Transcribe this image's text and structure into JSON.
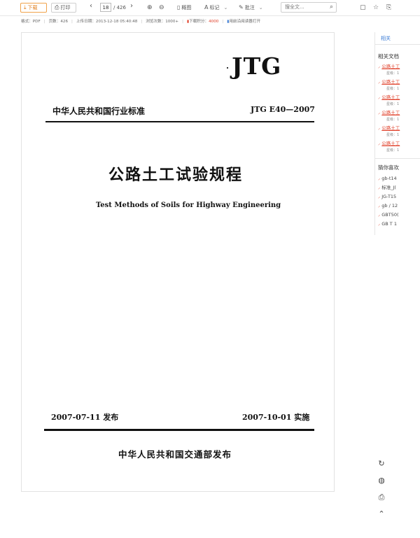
{
  "toolbar": {
    "download": "下载",
    "print": "打印",
    "page_current": "18",
    "page_total": "/ 426",
    "thumbnail": "概图",
    "mark": "标记",
    "annotate": "批注",
    "search_placeholder": "搜全文..."
  },
  "info": {
    "format": "格式：PDF",
    "pages": "页数：426",
    "upload": "上传日期：2013-12-18 05:40:48",
    "views": "浏览次数：1000+",
    "points_label": "下载积分：",
    "points_value": "4000",
    "app_open": "用前沿阅读器打开"
  },
  "document": {
    "logo": "JTG",
    "category": "中华人民共和国行业标准",
    "code": "JTG E40—2007",
    "title_cn": "公路土工试验规程",
    "title_en": "Test Methods of Soils for Highway Engineering",
    "issue_date": "2007-07-11 发布",
    "effective_date": "2007-10-01 实施",
    "publisher": "中华人民共和国交通部发布"
  },
  "sidebar": {
    "tab": "相关",
    "related_title": "相关文档",
    "related": [
      {
        "label": "公路土工",
        "sub": "星级：1"
      },
      {
        "label": "公路土工",
        "sub": "星级：1"
      },
      {
        "label": "公路土工",
        "sub": "星级：1"
      },
      {
        "label": "公路土工",
        "sub": "星级：1"
      },
      {
        "label": "公路土工",
        "sub": "星级：1"
      },
      {
        "label": "公路土工",
        "sub": "星级：1"
      }
    ],
    "guess_title": "猜你喜欢",
    "guess": [
      "gb-t14",
      "标准_J(",
      "JG-T15",
      "gb / 12",
      "GBT50(",
      "GB T 1"
    ]
  }
}
